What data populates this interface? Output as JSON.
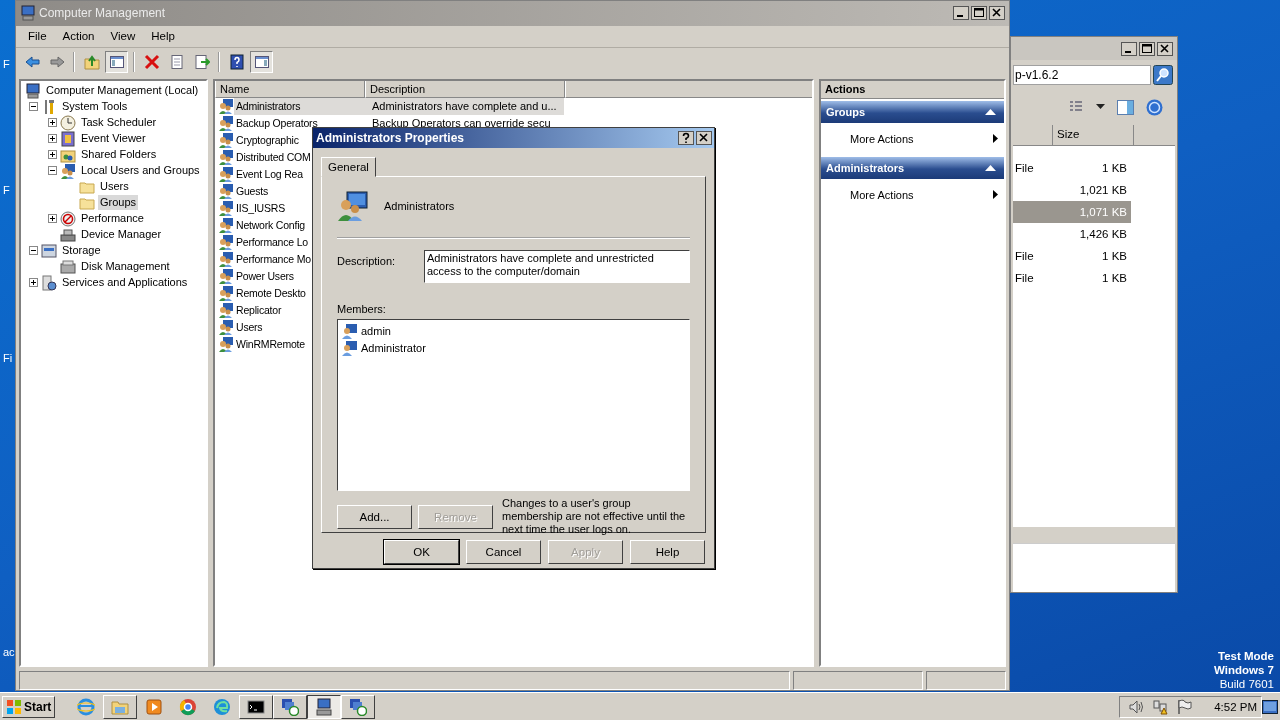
{
  "desktop": {
    "labels": [
      "F",
      "F",
      "Fi",
      "ac"
    ],
    "notice": [
      "Test Mode",
      "Windows 7",
      "Build 7601"
    ]
  },
  "explorer_window": {
    "search": {
      "value": "p-v1.6.2"
    },
    "columns": [
      "Size"
    ],
    "rows": [
      {
        "type": "File",
        "size": "1 KB",
        "selected": false
      },
      {
        "size": "1,021 KB",
        "selected": false
      },
      {
        "size": "1,071 KB",
        "selected": true
      },
      {
        "size": "1,426 KB",
        "selected": false
      },
      {
        "type": "File",
        "size": "1 KB",
        "selected": false
      },
      {
        "type": "File",
        "size": "1 KB",
        "selected": false
      }
    ]
  },
  "main_window": {
    "title": "Computer Management",
    "menu": [
      "File",
      "Action",
      "View",
      "Help"
    ],
    "toolbar": [
      {
        "kind": "back",
        "pressed": false
      },
      {
        "kind": "forward",
        "pressed": false
      },
      {
        "kind": "sep"
      },
      {
        "kind": "up",
        "pressed": false
      },
      {
        "kind": "tree",
        "pressed": true
      },
      {
        "kind": "sep"
      },
      {
        "kind": "delete",
        "pressed": false
      },
      {
        "kind": "properties",
        "pressed": false
      },
      {
        "kind": "export",
        "pressed": false
      },
      {
        "kind": "sep"
      },
      {
        "kind": "help",
        "pressed": false
      },
      {
        "kind": "pane",
        "pressed": true
      }
    ],
    "tree": [
      {
        "label": "Computer Management (Local)",
        "kind": "computer",
        "selected": false,
        "children": [
          {
            "label": "System Tools",
            "kind": "tools",
            "expanded": true,
            "selected": false,
            "children": [
              {
                "label": "Task Scheduler",
                "kind": "clock",
                "expanded": false,
                "selected": false
              },
              {
                "label": "Event Viewer",
                "kind": "log",
                "expanded": false,
                "selected": false
              },
              {
                "label": "Shared Folders",
                "kind": "share",
                "expanded": false,
                "selected": false
              },
              {
                "label": "Local Users and Groups",
                "kind": "users",
                "expanded": true,
                "selected": false,
                "children": [
                  {
                    "label": "Users",
                    "kind": "folder",
                    "selected": false
                  },
                  {
                    "label": "Groups",
                    "kind": "folder",
                    "selected": true
                  }
                ]
              },
              {
                "label": "Performance",
                "kind": "perf",
                "expanded": false,
                "selected": false
              },
              {
                "label": "Device Manager",
                "kind": "device",
                "selected": false
              }
            ]
          },
          {
            "label": "Storage",
            "kind": "storage",
            "expanded": true,
            "selected": false,
            "children": [
              {
                "label": "Disk Management",
                "kind": "disk",
                "selected": false
              }
            ]
          },
          {
            "label": "Services and Applications",
            "kind": "services",
            "expanded": false,
            "selected": false
          }
        ]
      }
    ],
    "list": {
      "columns": [
        "Name",
        "Description"
      ],
      "rows": [
        {
          "name": "Administrators",
          "description": "Administrators have complete and u...",
          "selected": true
        },
        {
          "name": "Backup Operators",
          "description": "Backup Operators can override secu",
          "selected": false
        },
        {
          "name": "Cryptographic",
          "selected": false
        },
        {
          "name": "Distributed COM",
          "selected": false
        },
        {
          "name": "Event Log Rea",
          "selected": false
        },
        {
          "name": "Guests",
          "selected": false
        },
        {
          "name": "IIS_IUSRS",
          "selected": false
        },
        {
          "name": "Network Config",
          "selected": false
        },
        {
          "name": "Performance Lo",
          "selected": false
        },
        {
          "name": "Performance Mo",
          "selected": false
        },
        {
          "name": "Power Users",
          "selected": false
        },
        {
          "name": "Remote Deskto",
          "selected": false
        },
        {
          "name": "Replicator",
          "selected": false
        },
        {
          "name": "Users",
          "selected": false
        },
        {
          "name": "WinRMRemote",
          "selected": false
        }
      ]
    },
    "actions": {
      "title": "Actions",
      "sections": [
        {
          "title": "Groups",
          "expanded": true,
          "items": [
            "More Actions"
          ]
        },
        {
          "title": "Administrators",
          "expanded": true,
          "items": [
            "More Actions"
          ]
        }
      ]
    }
  },
  "dialog": {
    "title": "Administrators Properties",
    "tabs": [
      {
        "label": "General",
        "selected": true
      }
    ],
    "name": "Administrators",
    "description_label": "Description:",
    "description": "Administrators have complete and unrestricted access to the computer/domain",
    "members_label": "Members:",
    "members": [
      "admin",
      "Administrator"
    ],
    "member_buttons": [
      {
        "label": "Add...",
        "disabled": false
      },
      {
        "label": "Remove",
        "disabled": true
      }
    ],
    "note": "Changes to a user's group membership are not effective until the next time the user logs on.",
    "buttons": [
      {
        "label": "OK",
        "default": true,
        "disabled": false
      },
      {
        "label": "Cancel",
        "default": false,
        "disabled": false
      },
      {
        "label": "Apply",
        "default": false,
        "disabled": true
      },
      {
        "label": "Help",
        "default": false,
        "disabled": false
      }
    ]
  },
  "taskbar": {
    "start": "Start",
    "apps": [
      {
        "kind": "ie",
        "running": false,
        "pressed": false
      },
      {
        "kind": "folder",
        "running": true,
        "pressed": false
      },
      {
        "kind": "media",
        "running": false,
        "pressed": false
      },
      {
        "kind": "chrome",
        "running": false,
        "pressed": false
      },
      {
        "kind": "edge",
        "running": false,
        "pressed": false
      },
      {
        "kind": "cmd",
        "running": true,
        "pressed": false
      },
      {
        "kind": "remote",
        "running": true,
        "pressed": false
      },
      {
        "kind": "computer",
        "running": true,
        "pressed": true
      },
      {
        "kind": "remote",
        "running": true,
        "pressed": false
      }
    ],
    "clock": "4:52 PM"
  }
}
